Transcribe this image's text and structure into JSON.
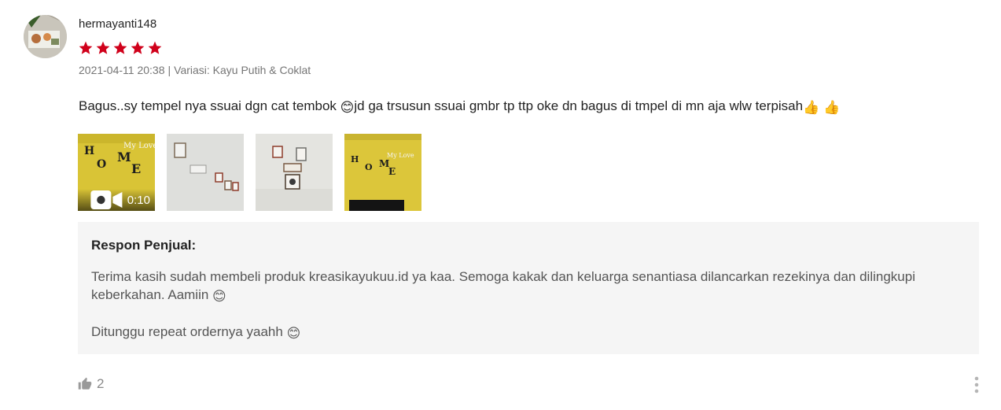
{
  "review": {
    "username": "hermayanti148",
    "rating": 5,
    "rating_max": 5,
    "date": "2021-04-11 20:38",
    "separator": "|",
    "variation": "Variasi: Kayu Putih & Coklat",
    "text_part1": "Bagus..sy tempel nya ssuai dgn cat tembok ",
    "text_part2": "jd ga trsusun ssuai gmbr tp ttp oke dn bagus di tmpel di mn aja wlw terpisah",
    "emoji_smile": "😊",
    "emoji_thumbs": "👍",
    "media": [
      {
        "type": "video",
        "duration": "0:10",
        "caption_letters": [
          "H",
          "O",
          "M",
          "E"
        ],
        "sign_text": "My Love"
      },
      {
        "type": "image"
      },
      {
        "type": "image"
      },
      {
        "type": "image",
        "caption_letters": [
          "H",
          "O",
          "M",
          "E"
        ],
        "sign_text": "My Love"
      }
    ]
  },
  "seller_reply": {
    "title": "Respon Penjual:",
    "paragraph1": "Terima kasih sudah membeli produk kreasikayukuu.id ya kaa.  Semoga kakak dan keluarga senantiasa dilancarkan rezekinya dan dilingkupi keberkahan. Aamiin ",
    "paragraph2": "Ditunggu repeat ordernya yaahh ",
    "emoji": "😊"
  },
  "footer": {
    "like_count": "2",
    "icons": {
      "like": "thumbs-up-icon",
      "more": "more-vertical-icon",
      "video": "video-camera-icon",
      "star": "star-icon"
    }
  },
  "colors": {
    "star": "#d0011b",
    "meta": "#757575",
    "reply_bg": "#f5f5f5",
    "wall_yellow": "#d9c436"
  }
}
